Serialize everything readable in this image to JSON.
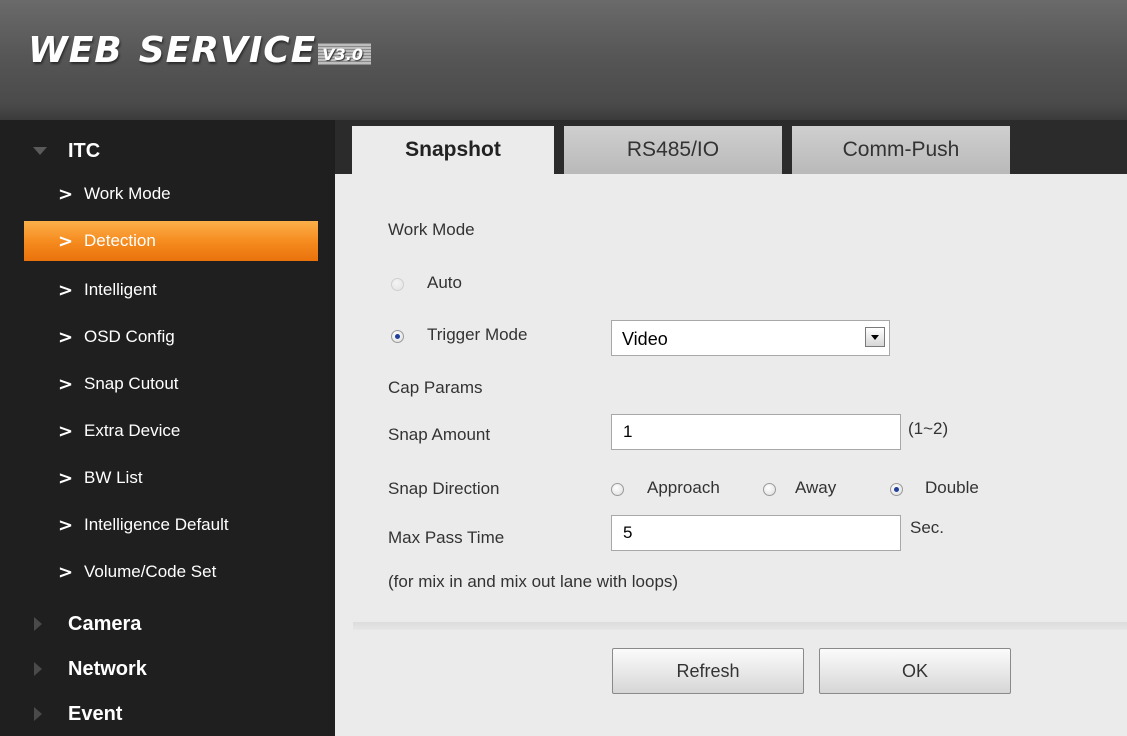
{
  "header": {
    "logo_main": "WEB",
    "logo_second": "SERVICE",
    "logo_version": "V3.0"
  },
  "sidebar": {
    "sections": [
      {
        "label": "ITC",
        "expanded": true
      },
      {
        "label": "Camera",
        "expanded": false
      },
      {
        "label": "Network",
        "expanded": false
      },
      {
        "label": "Event",
        "expanded": false
      }
    ],
    "items": [
      {
        "label": "Work Mode"
      },
      {
        "label": "Detection",
        "active": true
      },
      {
        "label": "Intelligent"
      },
      {
        "label": "OSD Config"
      },
      {
        "label": "Snap Cutout"
      },
      {
        "label": "Extra Device"
      },
      {
        "label": "BW List"
      },
      {
        "label": "Intelligence Default"
      },
      {
        "label": "Volume/Code Set"
      }
    ]
  },
  "tabs": [
    {
      "label": "Snapshot",
      "active": true
    },
    {
      "label": "RS485/IO",
      "active": false
    },
    {
      "label": "Comm-Push",
      "active": false
    }
  ],
  "form": {
    "work_mode_label": "Work Mode",
    "auto_label": "Auto",
    "trigger_mode_label": "Trigger Mode",
    "trigger_mode_value": "Video",
    "cap_params_label": "Cap Params",
    "snap_amount_label": "Snap Amount",
    "snap_amount_value": "1",
    "snap_amount_range": "(1~2)",
    "snap_direction_label": "Snap Direction",
    "direction_options": [
      "Approach",
      "Away",
      "Double"
    ],
    "direction_selected": "Double",
    "max_pass_time_label": "Max Pass Time",
    "max_pass_time_value": "5",
    "max_pass_time_unit": "Sec.",
    "note": "(for mix in and mix out lane with loops)"
  },
  "buttons": {
    "refresh": "Refresh",
    "ok": "OK"
  },
  "colors": {
    "accent_orange": "#f68c20",
    "sidebar_bg": "#1f1f1f",
    "header_bg": "#5a5a5a",
    "panel_bg": "#ebebeb"
  }
}
